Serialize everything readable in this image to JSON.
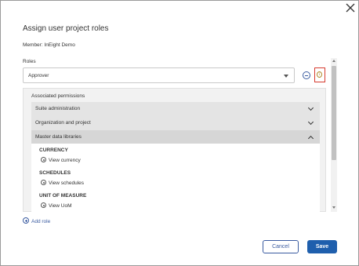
{
  "dialog": {
    "title": "Assign user project roles",
    "member": "Member: InEight Demo",
    "roles_label": "Roles",
    "close_icon": "close-icon"
  },
  "role_select": {
    "value": "Approver",
    "remove_icon": "minus-circle-icon",
    "info_icon": "info-icon",
    "info_glyph": "i"
  },
  "permissions": {
    "title": "Associated permissions",
    "sections": [
      {
        "label": "Suite administration",
        "expanded": false
      },
      {
        "label": "Organization and project",
        "expanded": false
      },
      {
        "label": "Master data libraries",
        "expanded": true
      }
    ],
    "groups": [
      {
        "title": "CURRENCY",
        "items": [
          "View currency"
        ]
      },
      {
        "title": "SCHEDULES",
        "items": [
          "View schedules"
        ]
      },
      {
        "title": "UNIT OF MEASURE",
        "items": [
          "View UoM"
        ]
      }
    ]
  },
  "add_role": {
    "label": "Add role"
  },
  "footer": {
    "cancel_label": "Cancel",
    "save_label": "Save"
  },
  "colors": {
    "accent": "#1f5fad",
    "highlight_border": "#d63b2f"
  }
}
